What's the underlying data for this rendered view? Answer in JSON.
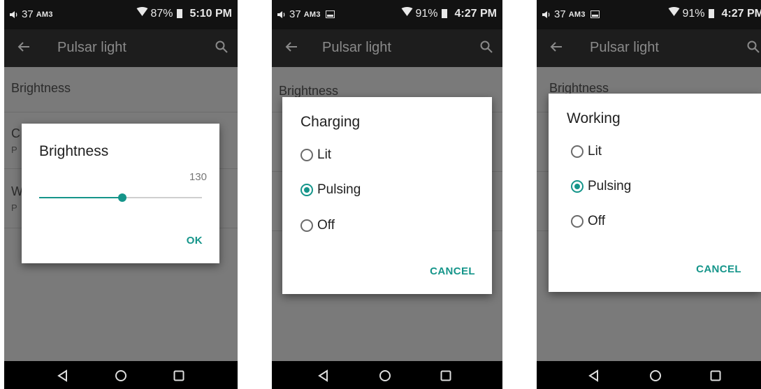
{
  "screens": [
    {
      "status": {
        "signal": "37",
        "carrier": "AM3",
        "battery": "87%",
        "time": "5:10 PM"
      },
      "toolbar": {
        "title": "Pulsar light"
      },
      "list": [
        {
          "title": "Brightness",
          "subtitle": ""
        },
        {
          "title": "C",
          "subtitle": "P"
        },
        {
          "title": "W",
          "subtitle": "P"
        }
      ],
      "dialog": {
        "title": "Brightness",
        "value": "130",
        "slider_fraction": 0.51,
        "action": "OK"
      }
    },
    {
      "status": {
        "signal": "37",
        "carrier": "AM3",
        "battery": "91%",
        "time": "4:27 PM"
      },
      "toolbar": {
        "title": "Pulsar light"
      },
      "list": [
        {
          "title": "Brightness"
        }
      ],
      "dialog": {
        "title": "Charging",
        "options": [
          {
            "label": "Lit",
            "selected": false
          },
          {
            "label": "Pulsing",
            "selected": true
          },
          {
            "label": "Off",
            "selected": false
          }
        ],
        "action": "CANCEL"
      }
    },
    {
      "status": {
        "signal": "37",
        "carrier": "AM3",
        "battery": "91%",
        "time": "4:27 PM"
      },
      "toolbar": {
        "title": "Pulsar light"
      },
      "list": [
        {
          "title": "Brightness"
        }
      ],
      "dialog": {
        "title": "Working",
        "options": [
          {
            "label": "Lit",
            "selected": false
          },
          {
            "label": "Pulsing",
            "selected": true
          },
          {
            "label": "Off",
            "selected": false
          }
        ],
        "action": "CANCEL"
      }
    }
  ],
  "colors": {
    "accent": "#15958a",
    "scrim": "#7a7a7a",
    "toolbar": "#1d1d1d",
    "statusbar": "#121212"
  },
  "icons": [
    "volume-icon",
    "image-icon",
    "wifi-icon",
    "battery-icon",
    "back-arrow-icon",
    "search-icon",
    "nav-back-icon",
    "nav-home-icon",
    "nav-recents-icon"
  ]
}
